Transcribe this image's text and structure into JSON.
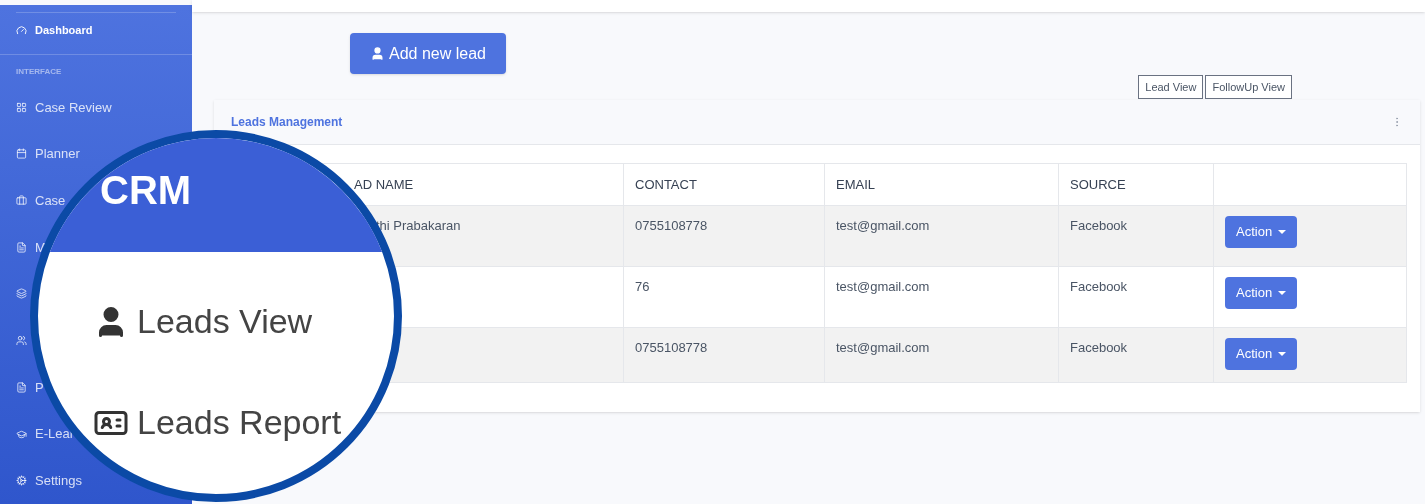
{
  "sidebar": {
    "items": [
      {
        "kind": "main",
        "label": "Dashboard"
      },
      {
        "kind": "heading",
        "label": "INTERFACE"
      },
      {
        "kind": "link",
        "label": "Case Review"
      },
      {
        "kind": "link",
        "label": "Planner"
      },
      {
        "kind": "link",
        "label": "Case"
      },
      {
        "kind": "link",
        "label": "M"
      },
      {
        "kind": "link"
      },
      {
        "kind": "link"
      },
      {
        "kind": "link",
        "label": "P"
      },
      {
        "kind": "link",
        "label": "E-Lear"
      },
      {
        "kind": "dropdown",
        "label": "Settings"
      }
    ]
  },
  "add_button": {
    "label": "Add new lead"
  },
  "view_buttons": [
    {
      "label": "Lead View"
    },
    {
      "label": "FollowUp View"
    }
  ],
  "card": {
    "title": "Leads Management",
    "table": {
      "columns": [
        "AD NAME",
        "CONTACT",
        "EMAIL",
        "SOURCE",
        ""
      ],
      "rows": [
        {
          "name": "thi Prabakaran",
          "contact": "0755108778",
          "email": "test@gmail.com",
          "source": "Facebook",
          "action": "Action"
        },
        {
          "name": "",
          "contact": "76",
          "email": "test@gmail.com",
          "source": "Facebook",
          "action": "Action"
        },
        {
          "name": "",
          "contact": "0755108778",
          "email": "test@gmail.com",
          "source": "Facebook",
          "action": "Action"
        }
      ]
    }
  },
  "magnifier": {
    "brand": "CRM",
    "items": [
      {
        "label": "Leads View"
      },
      {
        "label": "Leads Report"
      }
    ]
  }
}
